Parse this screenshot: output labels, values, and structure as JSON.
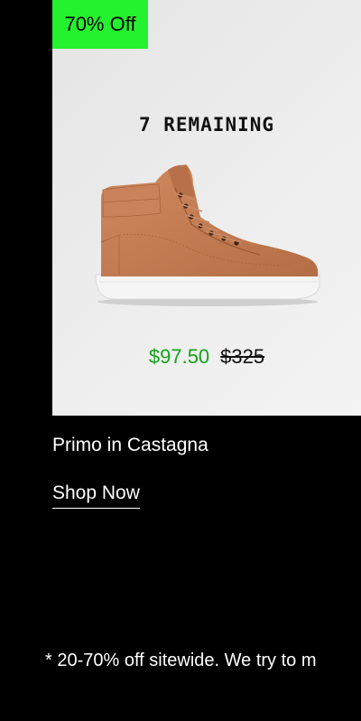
{
  "promo": {
    "badge": "70% Off",
    "stock": "7 REMAINING",
    "sale_price": "$97.50",
    "original_price": "$325",
    "product_name": "Primo in Castagna",
    "cta": "Shop Now"
  },
  "footer": {
    "disclaimer": "* 20-70% off sitewide. We try to m"
  },
  "colors": {
    "badge_bg": "#24f22e",
    "sale_price": "#14a31c",
    "page_bg": "#000000",
    "shoe_leather": "#c27a51",
    "sole": "#f4f4f4"
  }
}
